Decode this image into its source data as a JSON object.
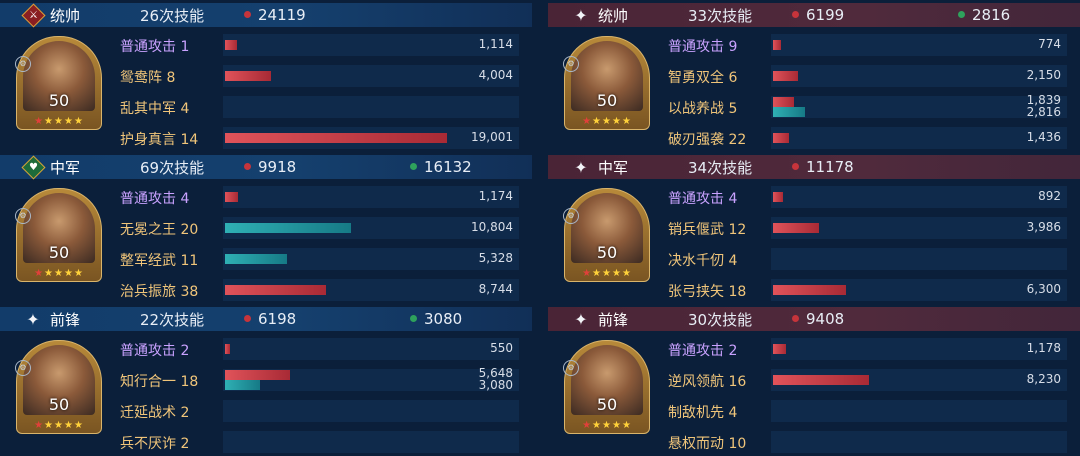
{
  "left": {
    "blocks": [
      {
        "role": "统帅",
        "skills": "26次技能",
        "val1": "24119",
        "val2": "",
        "level": "50",
        "rows": [
          {
            "name": "普通攻击 1",
            "color": "purple",
            "nums": [
              "1,114"
            ],
            "bars": [
              {
                "c": "red",
                "w": 12
              }
            ]
          },
          {
            "name": "鸳鸯阵 8",
            "color": "gold",
            "nums": [
              "4,004"
            ],
            "bars": [
              {
                "c": "red",
                "w": 46
              }
            ]
          },
          {
            "name": "乱其中军 4",
            "color": "gold",
            "nums": [],
            "bars": []
          },
          {
            "name": "护身真言 14",
            "color": "gold",
            "nums": [
              "19,001"
            ],
            "bars": [
              {
                "c": "red",
                "w": 222
              }
            ]
          }
        ]
      },
      {
        "role": "中军",
        "skills": "69次技能",
        "val1": "9918",
        "val2": "16132",
        "level": "50",
        "rows": [
          {
            "name": "普通攻击 4",
            "color": "purple",
            "nums": [
              "1,174"
            ],
            "bars": [
              {
                "c": "red",
                "w": 13
              }
            ]
          },
          {
            "name": "无冕之王 20",
            "color": "gold",
            "nums": [
              "10,804"
            ],
            "bars": [
              {
                "c": "teal",
                "w": 126
              }
            ]
          },
          {
            "name": "整军经武 11",
            "color": "gold",
            "nums": [
              "5,328"
            ],
            "bars": [
              {
                "c": "teal",
                "w": 62
              }
            ]
          },
          {
            "name": "治兵振旅 38",
            "color": "gold",
            "nums": [
              "8,744"
            ],
            "bars": [
              {
                "c": "red",
                "w": 101
              }
            ]
          }
        ]
      },
      {
        "role": "前锋",
        "skills": "22次技能",
        "val1": "6198",
        "val2": "3080",
        "level": "50",
        "rows": [
          {
            "name": "普通攻击 2",
            "color": "purple",
            "nums": [
              "550"
            ],
            "bars": [
              {
                "c": "red",
                "w": 5
              }
            ]
          },
          {
            "name": "知行合一 18",
            "color": "gold",
            "nums": [
              "5,648",
              "3,080"
            ],
            "bars": [
              {
                "c": "red",
                "w": 65
              },
              {
                "c": "teal",
                "w": 35
              }
            ]
          },
          {
            "name": "迁延战术 2",
            "color": "gold",
            "nums": [],
            "bars": []
          },
          {
            "name": "兵不厌诈 2",
            "color": "gold",
            "nums": [],
            "bars": []
          }
        ]
      }
    ]
  },
  "right": {
    "blocks": [
      {
        "role": "统帅",
        "skills": "33次技能",
        "val1": "6199",
        "val2": "2816",
        "level": "50",
        "rows": [
          {
            "name": "普通攻击 9",
            "color": "purple",
            "nums": [
              "774"
            ],
            "bars": [
              {
                "c": "red",
                "w": 8
              }
            ]
          },
          {
            "name": "智勇双全 6",
            "color": "gold",
            "nums": [
              "2,150"
            ],
            "bars": [
              {
                "c": "red",
                "w": 25
              }
            ]
          },
          {
            "name": "以战养战 5",
            "color": "gold",
            "nums": [
              "1,839",
              "2,816"
            ],
            "bars": [
              {
                "c": "red",
                "w": 21
              },
              {
                "c": "teal",
                "w": 32
              }
            ]
          },
          {
            "name": "破刃强袭 22",
            "color": "gold",
            "nums": [
              "1,436"
            ],
            "bars": [
              {
                "c": "red",
                "w": 16
              }
            ]
          }
        ]
      },
      {
        "role": "中军",
        "skills": "34次技能",
        "val1": "11178",
        "val2": "",
        "level": "50",
        "rows": [
          {
            "name": "普通攻击 4",
            "color": "purple",
            "nums": [
              "892"
            ],
            "bars": [
              {
                "c": "red",
                "w": 10
              }
            ]
          },
          {
            "name": "销兵偃武 12",
            "color": "gold",
            "nums": [
              "3,986"
            ],
            "bars": [
              {
                "c": "red",
                "w": 46
              }
            ]
          },
          {
            "name": "决水千仞 4",
            "color": "gold",
            "nums": [],
            "bars": []
          },
          {
            "name": "张弓挟矢 18",
            "color": "gold",
            "nums": [
              "6,300"
            ],
            "bars": [
              {
                "c": "red",
                "w": 73
              }
            ]
          }
        ]
      },
      {
        "role": "前锋",
        "skills": "30次技能",
        "val1": "9408",
        "val2": "",
        "level": "50",
        "rows": [
          {
            "name": "普通攻击 2",
            "color": "purple",
            "nums": [
              "1,178"
            ],
            "bars": [
              {
                "c": "red",
                "w": 13
              }
            ]
          },
          {
            "name": "逆风领航 16",
            "color": "gold",
            "nums": [
              "8,230"
            ],
            "bars": [
              {
                "c": "red",
                "w": 96
              }
            ]
          },
          {
            "name": "制敌机先 4",
            "color": "gold",
            "nums": [],
            "bars": []
          },
          {
            "name": "悬权而动 10",
            "color": "gold",
            "nums": [],
            "bars": []
          }
        ]
      }
    ]
  }
}
